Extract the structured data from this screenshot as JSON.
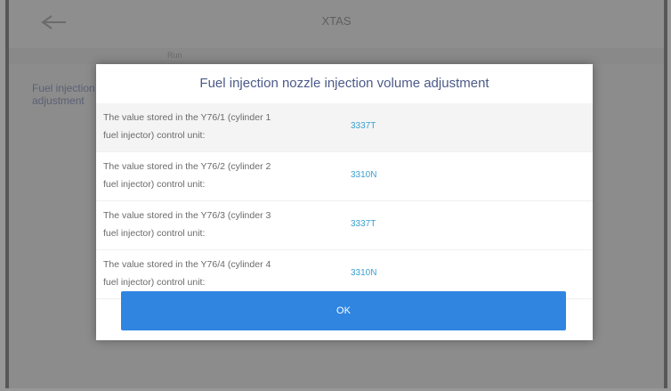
{
  "header": {
    "title": "XTAS",
    "back_icon": "back-arrow-icon"
  },
  "subbar": {
    "label": "Run"
  },
  "background_list": {
    "item_text": "Fuel injection nozzle injection volume adjustment"
  },
  "dialog": {
    "title": "Fuel injection nozzle injection volume adjustment",
    "rows": [
      {
        "label_line1": "The value stored in the Y76/1 (cylinder 1",
        "label_line2": "fuel injector) control unit:",
        "value": "3337T"
      },
      {
        "label_line1": "The value stored in the Y76/2 (cylinder 2",
        "label_line2": "fuel injector) control unit:",
        "value": "3310N"
      },
      {
        "label_line1": "The value stored in the Y76/3 (cylinder 3",
        "label_line2": "fuel injector) control unit:",
        "value": "3337T"
      },
      {
        "label_line1": "The value stored in the Y76/4 (cylinder 4",
        "label_line2": "fuel injector) control unit:",
        "value": "3310N"
      }
    ],
    "ok_label": "OK"
  },
  "colors": {
    "accent": "#2f85e0",
    "value_text": "#3aa0d0",
    "title_text": "#4b5a88"
  }
}
